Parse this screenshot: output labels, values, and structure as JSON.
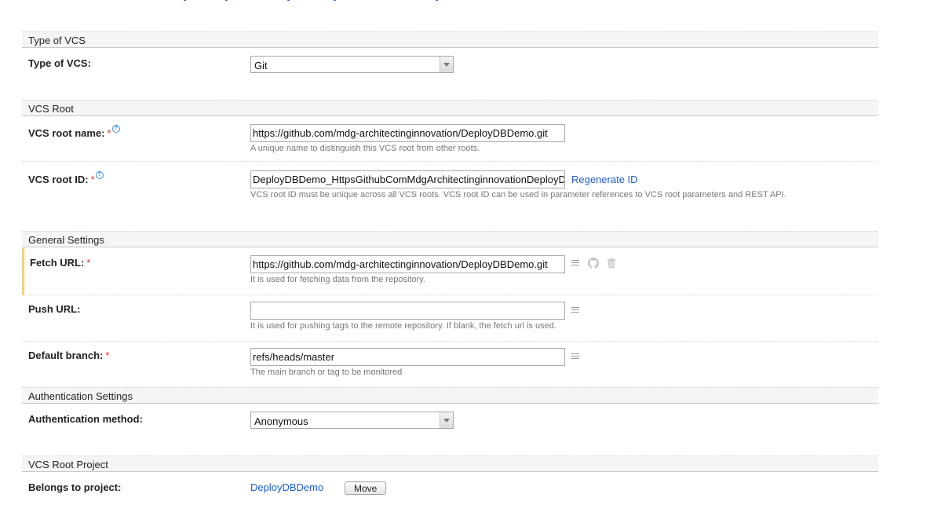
{
  "sections": {
    "type_of_vcs": "Type of VCS",
    "vcs_root": "VCS Root",
    "general_settings": "General Settings",
    "authentication_settings": "Authentication Settings",
    "vcs_root_project": "VCS Root Project"
  },
  "type_of_vcs": {
    "label": "Type of VCS:",
    "value": "Git"
  },
  "vcs_root_name": {
    "label": "VCS root name:",
    "required": "*",
    "help": "?",
    "value": "https://github.com/mdg-architectinginnovation/DeployDBDemo.git",
    "hint": "A unique name to distinguish this VCS root from other roots."
  },
  "vcs_root_id": {
    "label": "VCS root ID:",
    "required": "*",
    "help": "?",
    "value": "DeployDBDemo_HttpsGithubComMdgArchitectinginnovationDeployD",
    "regenerate_link": "Regenerate ID",
    "hint": "VCS root ID must be unique across all VCS roots. VCS root ID can be used in parameter references to VCS root parameters and REST API."
  },
  "fetch_url": {
    "label": "Fetch URL:",
    "required": "*",
    "value": "https://github.com/mdg-architectinginnovation/DeployDBDemo.git",
    "hint": "It is used for fetching data from the repository."
  },
  "push_url": {
    "label": "Push URL:",
    "value": "",
    "hint": "It is used for pushing tags to the remote repository. If blank, the fetch url is used."
  },
  "default_branch": {
    "label": "Default branch:",
    "required": "*",
    "value": "refs/heads/master",
    "hint": "The main branch or tag to be monitored"
  },
  "auth_method": {
    "label": "Authentication method:",
    "value": "Anonymous"
  },
  "belongs_to_project": {
    "label": "Belongs to project:",
    "project_link": "DeployDBDemo",
    "move_button": "Move"
  },
  "icons": [
    "list-icon",
    "github-icon",
    "trash-icon",
    "help-icon",
    "dropdown-arrow-icon"
  ],
  "colors": {
    "link": "#1f5fbf",
    "required": "#dd3333",
    "highlight_bar": "#f5d474",
    "help": "#3c8fd6"
  }
}
